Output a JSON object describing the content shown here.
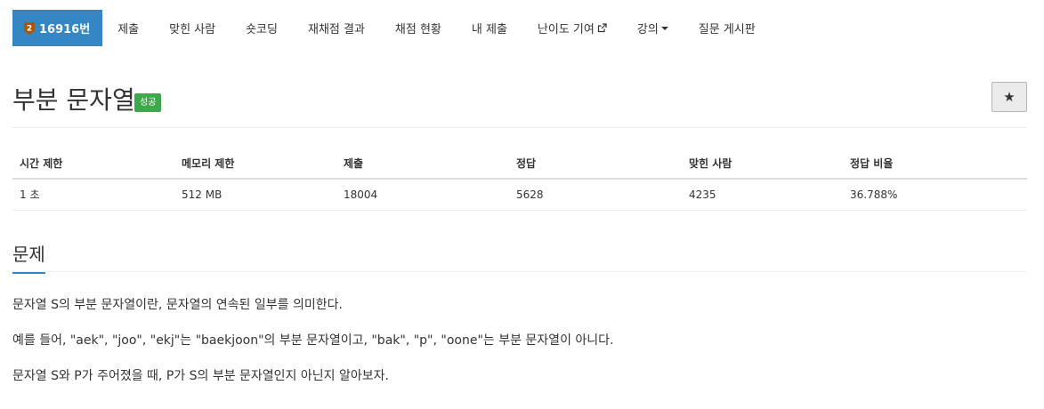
{
  "menu": {
    "items": [
      {
        "label": "16916번",
        "active": true
      },
      {
        "label": "제출"
      },
      {
        "label": "맞힌 사람"
      },
      {
        "label": "숏코딩"
      },
      {
        "label": "재채점 결과"
      },
      {
        "label": "채점 현황"
      },
      {
        "label": "내 제출"
      },
      {
        "label": "난이도 기여"
      },
      {
        "label": "강의"
      },
      {
        "label": "질문 게시판"
      }
    ],
    "tier_badge_text": "2",
    "tier_color": "#ad5600"
  },
  "problem": {
    "title": "부분 문자열",
    "result_badge": "성공",
    "star_label": "★"
  },
  "info": {
    "headers": [
      "시간 제한",
      "메모리 제한",
      "제출",
      "정답",
      "맞힌 사람",
      "정답 비율"
    ],
    "values": [
      "1 초",
      "512 MB",
      "18004",
      "5628",
      "4235",
      "36.788%"
    ]
  },
  "section": {
    "title": "문제",
    "paragraphs": [
      "문자열 S의 부분 문자열이란, 문자열의 연속된 일부를 의미한다.",
      "예를 들어, \"aek\", \"joo\", \"ekj\"는 \"baekjoon\"의 부분 문자열이고, \"bak\", \"p\", \"oone\"는 부분 문자열이 아니다.",
      "문자열 S와 P가 주어졌을 때, P가 S의 부분 문자열인지 아닌지 알아보자."
    ]
  },
  "colors": {
    "accent": "#3487c4",
    "success": "#3ea84a"
  }
}
